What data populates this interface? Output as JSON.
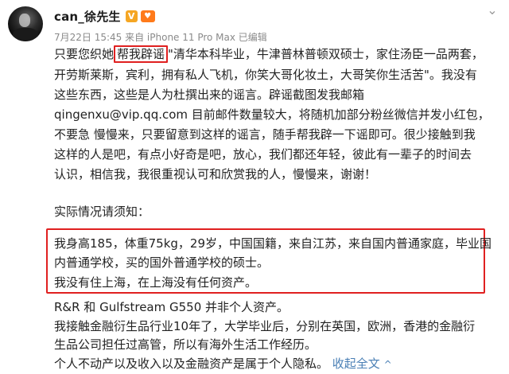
{
  "post": {
    "username": "can_徐先生",
    "vip_badge": "V",
    "heart_badge": "♥",
    "meta": "7月22日 15:45 来自 iPhone 11 Pro Max 已编辑",
    "more_icon": "chevron-down-icon"
  },
  "body": {
    "line1_pre": "只要您织她",
    "line1_hl": "帮我辟谣",
    "line1_post": "\"清华本科毕业，牛津普林普顿双硕士，家住汤臣一品两套，",
    "line2": "开劳斯莱斯，宾利，拥有私人飞机，你笑大哥化妆土，大哥笑你生活苦\"。我没有",
    "line3": "这些东西，这些是人为杜撰出来的谣言。辟谣截图发我邮箱",
    "line4": "qingenxu@vip.qq.com 目前邮件数量较大，将随机加部分粉丝微信并发小红包，",
    "line5": "不要急 慢慢来，只要留意到这样的谣言，随手帮我辟一下谣即可。很少接触到我",
    "line6": "这样的人是吧，有点小好奇是吧，放心，我们都还年轻，彼此有一辈子的时间去",
    "line7": "认识，相信我，我很重视认可和欣赏我的人，慢慢来，谢谢！",
    "line8": "实际情况请须知：",
    "line9": "我身高185，体重75kg，29岁，中国国籍，来自江苏，来自国内普通家庭，毕业国",
    "line10": "内普通学校，买的国外普通学校的硕士。",
    "line11": "我没有住上海，在上海没有任何资产。",
    "line12": "R&R 和  Gulfstream G550  并非个人资产。",
    "line13": "我接触金融衍生品行业10年了，大学毕业后，分别在英国，欧洲，香港的金融衍",
    "line14": "生品公司担任过高管，所以有海外生活工作经历。",
    "line15_pre": "个人不动产以及收入以及金融资产是属于个人隐私。",
    "line15_link": "收起全文",
    "collapse_icon": "^"
  }
}
